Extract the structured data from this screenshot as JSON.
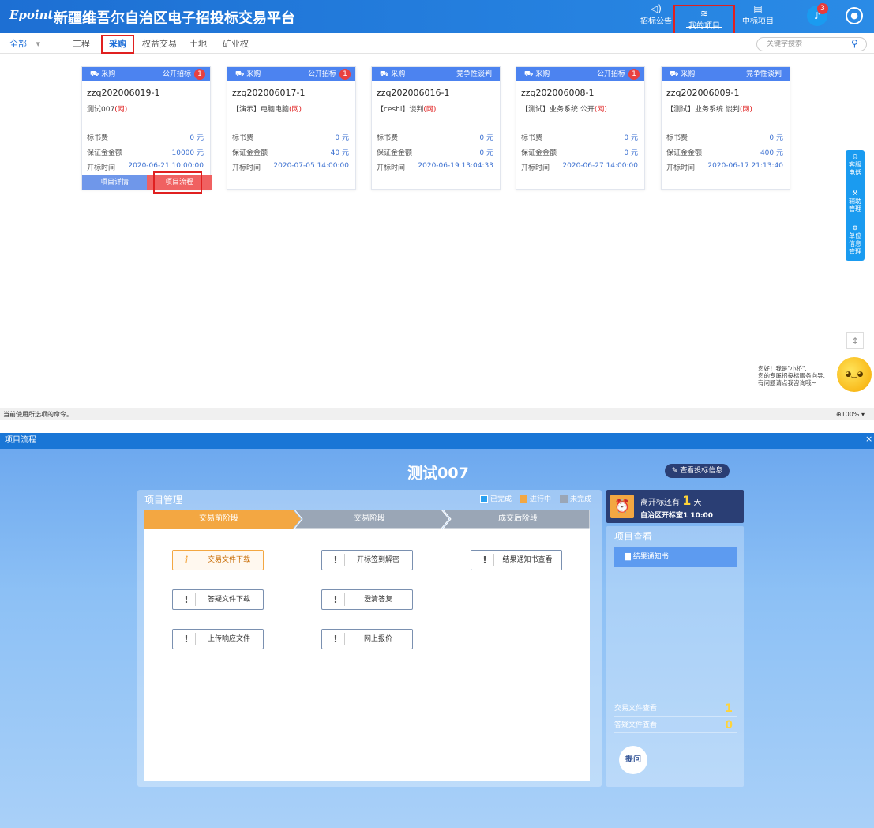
{
  "header": {
    "logo": "Epoint",
    "title": "新疆维吾尔自治区电子招投标交易平台",
    "nav": [
      {
        "label": "招标公告",
        "icon": "speaker-icon"
      },
      {
        "label": "我的项目",
        "icon": "layers-icon"
      },
      {
        "label": "中标项目",
        "icon": "document-icon"
      }
    ],
    "bell_count": "3"
  },
  "subnav": {
    "all_label": "全部",
    "tabs": [
      "工程",
      "采购",
      "权益交易",
      "土地",
      "矿业权"
    ],
    "search_placeholder": "关键字搜索"
  },
  "cards": [
    {
      "category": "采购",
      "type": "公开招标",
      "badge": "1",
      "id": "zzq202006019-1",
      "name": "测试007",
      "suffix": "(网)",
      "fee_label": "标书费",
      "fee": "0 元",
      "deposit_label": "保证金金额",
      "deposit": "10000 元",
      "open_label": "开标时间",
      "open": "2020-06-21 10:00:00",
      "btn_detail": "项目详情",
      "btn_flow": "项目流程"
    },
    {
      "category": "采购",
      "type": "公开招标",
      "badge": "1",
      "id": "zzq202006017-1",
      "name": "【演示】电脑电脑",
      "suffix": "(网)",
      "fee_label": "标书费",
      "fee": "0 元",
      "deposit_label": "保证金金额",
      "deposit": "40 元",
      "open_label": "开标时间",
      "open": "2020-07-05 14:00:00"
    },
    {
      "category": "采购",
      "type": "竞争性谈判",
      "badge": "",
      "id": "zzq202006016-1",
      "name": "【ceshi】谈判",
      "suffix": "(网)",
      "fee_label": "标书费",
      "fee": "0 元",
      "deposit_label": "保证金金额",
      "deposit": "0 元",
      "open_label": "开标时间",
      "open": "2020-06-19 13:04:33"
    },
    {
      "category": "采购",
      "type": "公开招标",
      "badge": "1",
      "id": "zzq202006008-1",
      "name": "【测试】业务系统 公开",
      "suffix": "(网)",
      "fee_label": "标书费",
      "fee": "0 元",
      "deposit_label": "保证金金额",
      "deposit": "0 元",
      "open_label": "开标时间",
      "open": "2020-06-27 14:00:00"
    },
    {
      "category": "采购",
      "type": "竞争性谈判",
      "badge": "",
      "id": "zzq202006009-1",
      "name": "【测试】业务系统 谈判",
      "suffix": "(网)",
      "fee_label": "标书费",
      "fee": "0 元",
      "deposit_label": "保证金金额",
      "deposit": "400 元",
      "open_label": "开标时间",
      "open": "2020-06-17 21:13:40"
    }
  ],
  "sidetools": [
    "客服电话",
    "辅助管理",
    "单位信息管理"
  ],
  "chat": {
    "line1": "您好！我是\"小桥\",",
    "line2": "您的专属招投标服务向导,",
    "line3": "有问题请点我咨询哦~"
  },
  "statusbar": {
    "left": "当前使用所选项的命令。",
    "zoom": "100%"
  },
  "dialog": {
    "title": "项目流程",
    "project_name": "测试007",
    "view_bid_btn": "查看投标信息",
    "mgmt_title": "项目管理",
    "legend": [
      {
        "label": "已完成",
        "color": "#2aa0f0"
      },
      {
        "label": "进行中",
        "color": "#f3a742"
      },
      {
        "label": "未完成",
        "color": "#9aa6b6"
      }
    ],
    "stages": [
      "交易前阶段",
      "交易阶段",
      "成交后阶段"
    ],
    "tasks": [
      {
        "label": "交易文件下载",
        "icon": "i"
      },
      {
        "label": "答疑文件下载",
        "icon": "!"
      },
      {
        "label": "上传响应文件",
        "icon": "!"
      },
      {
        "label": "开标签到解密",
        "icon": "!"
      },
      {
        "label": "澄清答复",
        "icon": "!"
      },
      {
        "label": "网上报价",
        "icon": "!"
      },
      {
        "label": "结果通知书查看",
        "icon": "!"
      }
    ],
    "countdown": {
      "prefix": "离开标还有",
      "days": "1",
      "unit": "天",
      "place": "自治区开标室1 10:00"
    },
    "info_title": "项目查看",
    "notice_btn": "结果通知书",
    "stats": [
      {
        "label": "交易文件查看",
        "count": "1"
      },
      {
        "label": "答疑文件查看",
        "count": "0"
      }
    ],
    "ask_btn": "提问"
  }
}
